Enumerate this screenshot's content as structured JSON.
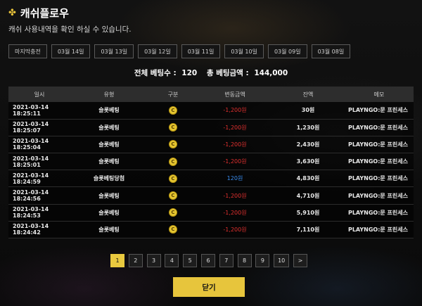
{
  "header": {
    "icon": "clover-icon",
    "title": "캐쉬플로우",
    "subtitle": "캐쉬 사용내역을 확인 하실 수 있습니다."
  },
  "tabs": [
    {
      "label": "마지막충전",
      "active": true
    },
    {
      "label": "03월 14일",
      "active": false
    },
    {
      "label": "03월 13일",
      "active": false
    },
    {
      "label": "03월 12일",
      "active": false
    },
    {
      "label": "03월 11일",
      "active": false
    },
    {
      "label": "03월 10일",
      "active": false
    },
    {
      "label": "03월 09일",
      "active": false
    },
    {
      "label": "03월 08일",
      "active": false
    }
  ],
  "summary": {
    "total_bets_label": "전체 베팅수 :",
    "total_bets_value": "120",
    "total_amount_label": "총 베팅금액 :",
    "total_amount_value": "144,000"
  },
  "table": {
    "columns": [
      "일시",
      "유형",
      "구분",
      "변동금액",
      "잔액",
      "메모"
    ],
    "rows": [
      {
        "datetime": "2021-03-14 18:25:11",
        "type": "슬롯베팅",
        "category": "C",
        "change": "-1,200원",
        "sign": "minus",
        "balance": "30원",
        "memo": "PLAYNGO:문 프린세스"
      },
      {
        "datetime": "2021-03-14 18:25:07",
        "type": "슬롯베팅",
        "category": "C",
        "change": "-1,200원",
        "sign": "minus",
        "balance": "1,230원",
        "memo": "PLAYNGO:문 프린세스"
      },
      {
        "datetime": "2021-03-14 18:25:04",
        "type": "슬롯베팅",
        "category": "C",
        "change": "-1,200원",
        "sign": "minus",
        "balance": "2,430원",
        "memo": "PLAYNGO:문 프린세스"
      },
      {
        "datetime": "2021-03-14 18:25:01",
        "type": "슬롯베팅",
        "category": "C",
        "change": "-1,200원",
        "sign": "minus",
        "balance": "3,630원",
        "memo": "PLAYNGO:문 프린세스"
      },
      {
        "datetime": "2021-03-14 18:24:59",
        "type": "슬롯베팅당첨",
        "category": "C",
        "change": "120원",
        "sign": "plus",
        "balance": "4,830원",
        "memo": "PLAYNGO:문 프린세스"
      },
      {
        "datetime": "2021-03-14 18:24:56",
        "type": "슬롯베팅",
        "category": "C",
        "change": "-1,200원",
        "sign": "minus",
        "balance": "4,710원",
        "memo": "PLAYNGO:문 프린세스"
      },
      {
        "datetime": "2021-03-14 18:24:53",
        "type": "슬롯베팅",
        "category": "C",
        "change": "-1,200원",
        "sign": "minus",
        "balance": "5,910원",
        "memo": "PLAYNGO:문 프린세스"
      },
      {
        "datetime": "2021-03-14 18:24:42",
        "type": "슬롯베팅",
        "category": "C",
        "change": "-1,200원",
        "sign": "minus",
        "balance": "7,110원",
        "memo": "PLAYNGO:문 프린세스"
      }
    ]
  },
  "pagination": {
    "pages": [
      "1",
      "2",
      "3",
      "4",
      "5",
      "6",
      "7",
      "8",
      "9",
      "10"
    ],
    "current": "1",
    "next": ">"
  },
  "close_button": {
    "label": "닫기"
  },
  "colors": {
    "accent": "#e9c93f",
    "negative": "#e0302f",
    "positive": "#3a8ef0"
  }
}
